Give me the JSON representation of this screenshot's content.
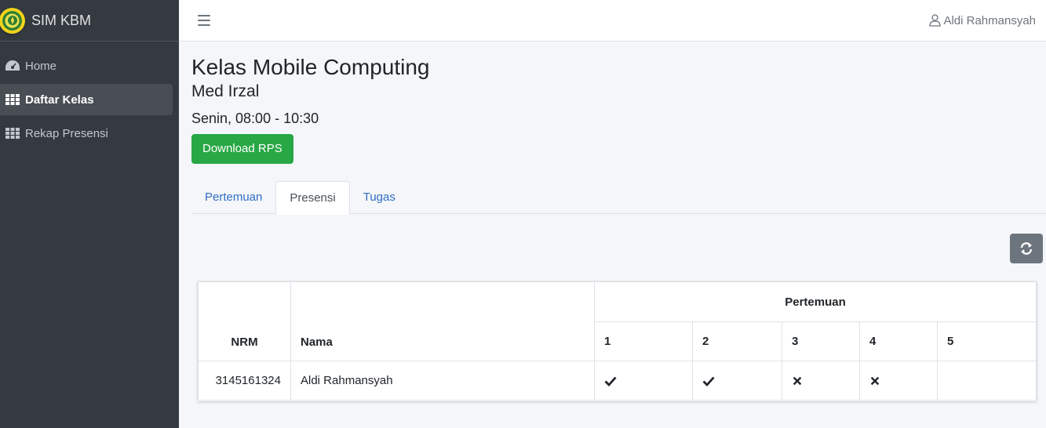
{
  "brand": {
    "name": "SIM KBM",
    "logo_icon": "university-seal-icon"
  },
  "sidebar": {
    "items": [
      {
        "label": "Home",
        "icon": "dashboard-gauge-icon",
        "active": false
      },
      {
        "label": "Daftar Kelas",
        "icon": "grid-table-icon",
        "active": true
      },
      {
        "label": "Rekap Presensi",
        "icon": "grid-table-icon",
        "active": false
      }
    ]
  },
  "topbar": {
    "user_name": "Aldi Rahmansyah",
    "user_icon": "user-icon",
    "menu_icon": "hamburger-icon"
  },
  "page": {
    "title": "Kelas Mobile Computing",
    "lecturer": "Med Irzal",
    "schedule": "Senin, 08:00 - 10:30",
    "download_label": "Download RPS"
  },
  "tabs": [
    {
      "label": "Pertemuan",
      "active": false
    },
    {
      "label": "Presensi",
      "active": true
    },
    {
      "label": "Tugas",
      "active": false
    }
  ],
  "refresh_icon": "refresh-icon",
  "table": {
    "headers": {
      "nrm": "NRM",
      "nama": "Nama",
      "group": "Pertemuan"
    },
    "meetings": [
      "1",
      "2",
      "3",
      "4",
      "5"
    ],
    "rows": [
      {
        "nrm": "3145161324",
        "nama": "Aldi Rahmansyah",
        "attendance": [
          "present",
          "present",
          "absent",
          "absent",
          ""
        ]
      }
    ]
  },
  "colors": {
    "sidebar": "#343a40",
    "accent_link": "#2f6fc4",
    "success": "#28a745",
    "secondary": "#6c757d"
  }
}
